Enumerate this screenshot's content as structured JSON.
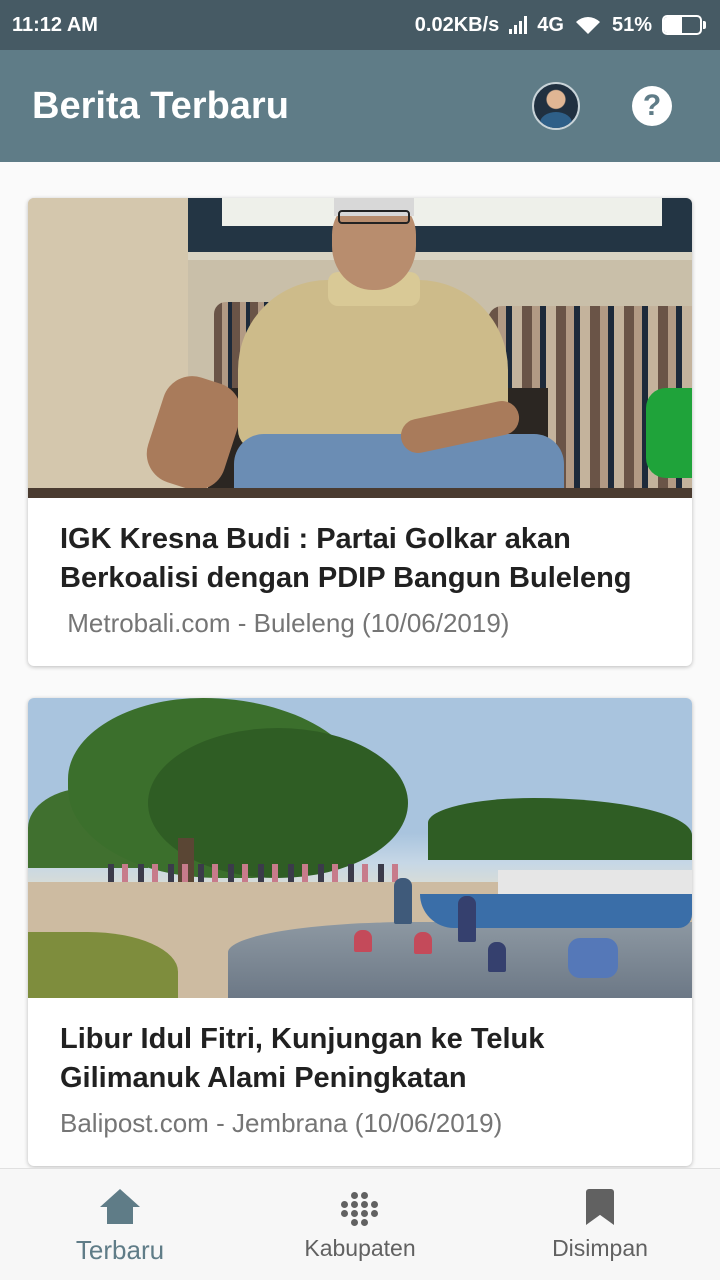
{
  "status_bar": {
    "time": "11:12 AM",
    "network_speed": "0.02KB/s",
    "network_type": "4G",
    "battery": "51%",
    "battery_level": 0.51,
    "icons": [
      "signal-icon",
      "wifi-icon",
      "battery-charging-icon"
    ]
  },
  "app_bar": {
    "title": "Berita Terbaru",
    "icons": [
      "avatar",
      "help-icon"
    ],
    "help_symbol": "?"
  },
  "articles": [
    {
      "title": "IGK Kresna Budi : Partai Golkar akan Berkoalisi dengan PDIP Bangun Buleleng",
      "meta": " Metrobali.com - Buleleng (10/06/2019)"
    },
    {
      "title": "Libur Idul Fitri, Kunjungan ke Teluk Gilimanuk Alami Peningkatan",
      "meta": "Balipost.com - Jembrana (10/06/2019)"
    }
  ],
  "bottom_nav": {
    "items": [
      {
        "label": "Terbaru",
        "icon": "home-icon",
        "active": true
      },
      {
        "label": "Kabupaten",
        "icon": "dots-grid-icon",
        "active": false
      },
      {
        "label": "Disimpan",
        "icon": "bookmark-icon",
        "active": false
      }
    ]
  },
  "colors": {
    "status_bar": "#465a64",
    "app_bar": "#5f7c87",
    "active_nav": "#5f7c87",
    "inactive_nav": "#616161"
  }
}
